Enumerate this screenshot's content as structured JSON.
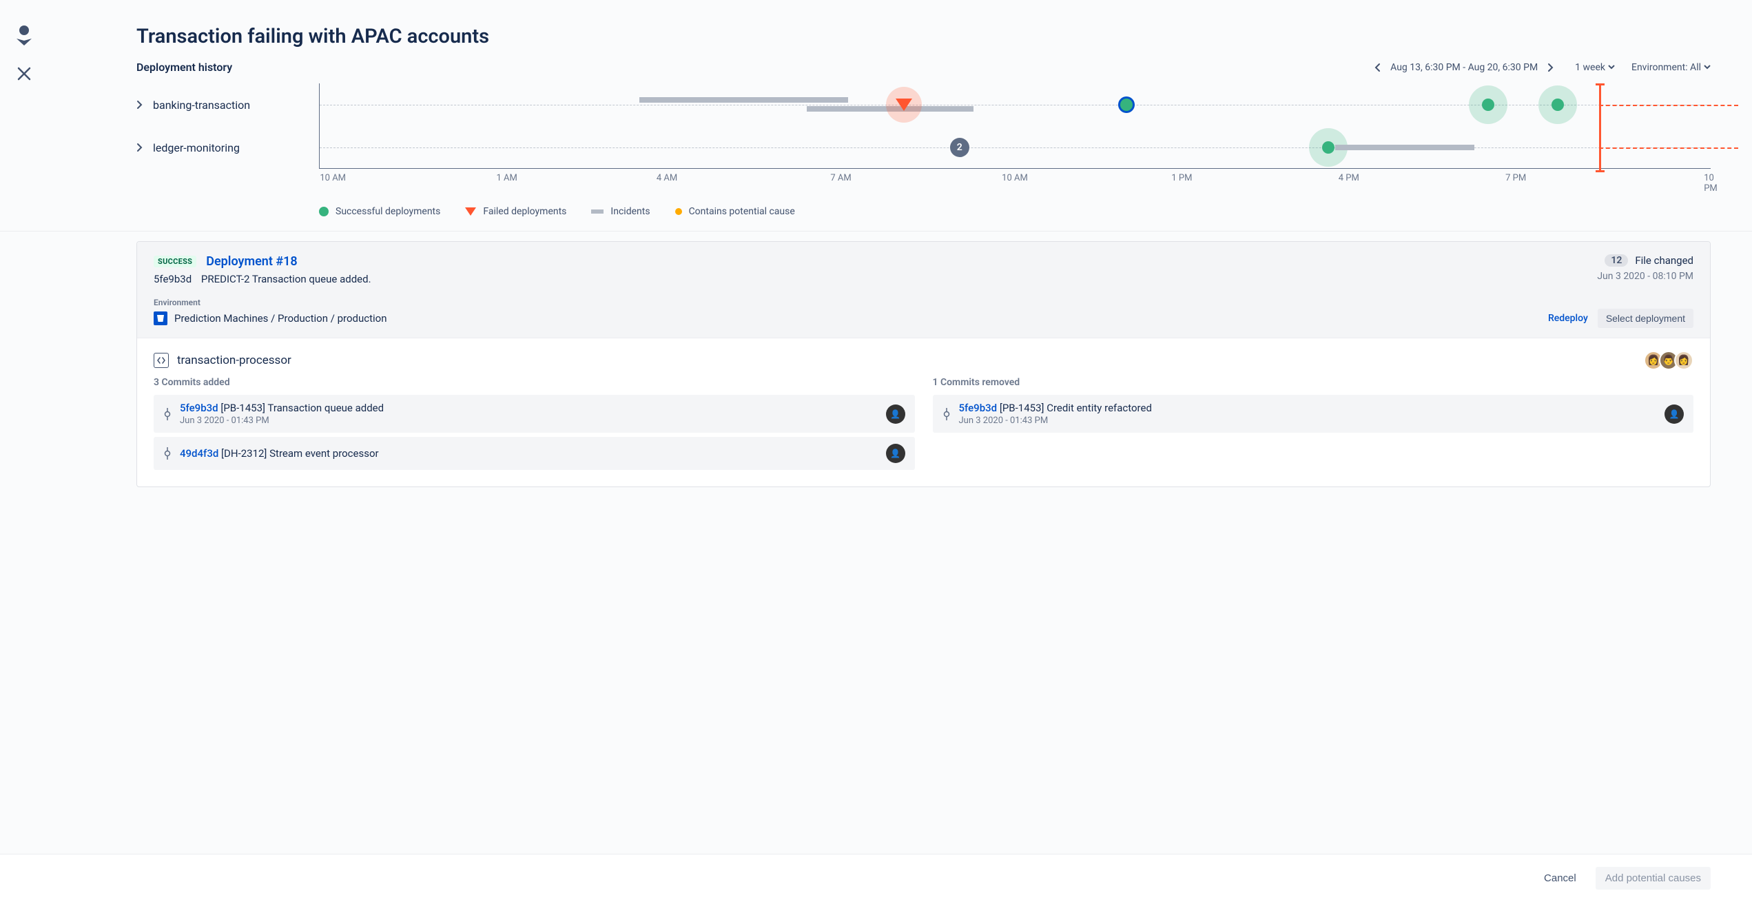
{
  "page": {
    "title": "Transaction failing with APAC accounts",
    "history_label": "Deployment history",
    "range": "Aug 13, 6:30 PM - Aug 20, 6:30 PM",
    "period": "1 week",
    "environment_label": "Environment: All"
  },
  "timeline": {
    "rows": [
      {
        "label": "banking-transaction"
      },
      {
        "label": "ledger-monitoring"
      }
    ],
    "ticks": [
      "10 AM",
      "1 AM",
      "4 AM",
      "7 AM",
      "10 AM",
      "1 PM",
      "4 PM",
      "7 PM",
      "10 PM"
    ],
    "cluster_count": "2"
  },
  "legend": {
    "success": "Successful deployments",
    "failed": "Failed deployments",
    "incidents": "Incidents",
    "potential": "Contains potential cause"
  },
  "deployment": {
    "status": "SUCCESS",
    "title": "Deployment #18",
    "hash": "5fe9b3d",
    "ticket": "PREDICT-2",
    "subject": "Transaction queue added.",
    "env_label": "Environment",
    "env_path": "Prediction Machines / Production / production",
    "files_count": "12",
    "files_label": "File changed",
    "datetime": "Jun 3 2020 - 08:10 PM",
    "redeploy": "Redeploy",
    "select": "Select deployment"
  },
  "repo": {
    "name": "transaction-processor",
    "added_label": "3 Commits added",
    "removed_label": "1 Commits removed",
    "added": [
      {
        "hash": "5fe9b3d",
        "title": "[PB-1453] Transaction queue added",
        "meta": "Jun 3 2020 - 01:43 PM"
      },
      {
        "hash": "49d4f3d",
        "title": "[DH-2312] Stream event processor",
        "meta": ""
      }
    ],
    "removed": [
      {
        "hash": "5fe9b3d",
        "title": "[PB-1453] Credit entity refactored",
        "meta": "Jun 3 2020 - 01:43 PM"
      }
    ]
  },
  "footer": {
    "cancel": "Cancel",
    "add": "Add potential causes"
  }
}
